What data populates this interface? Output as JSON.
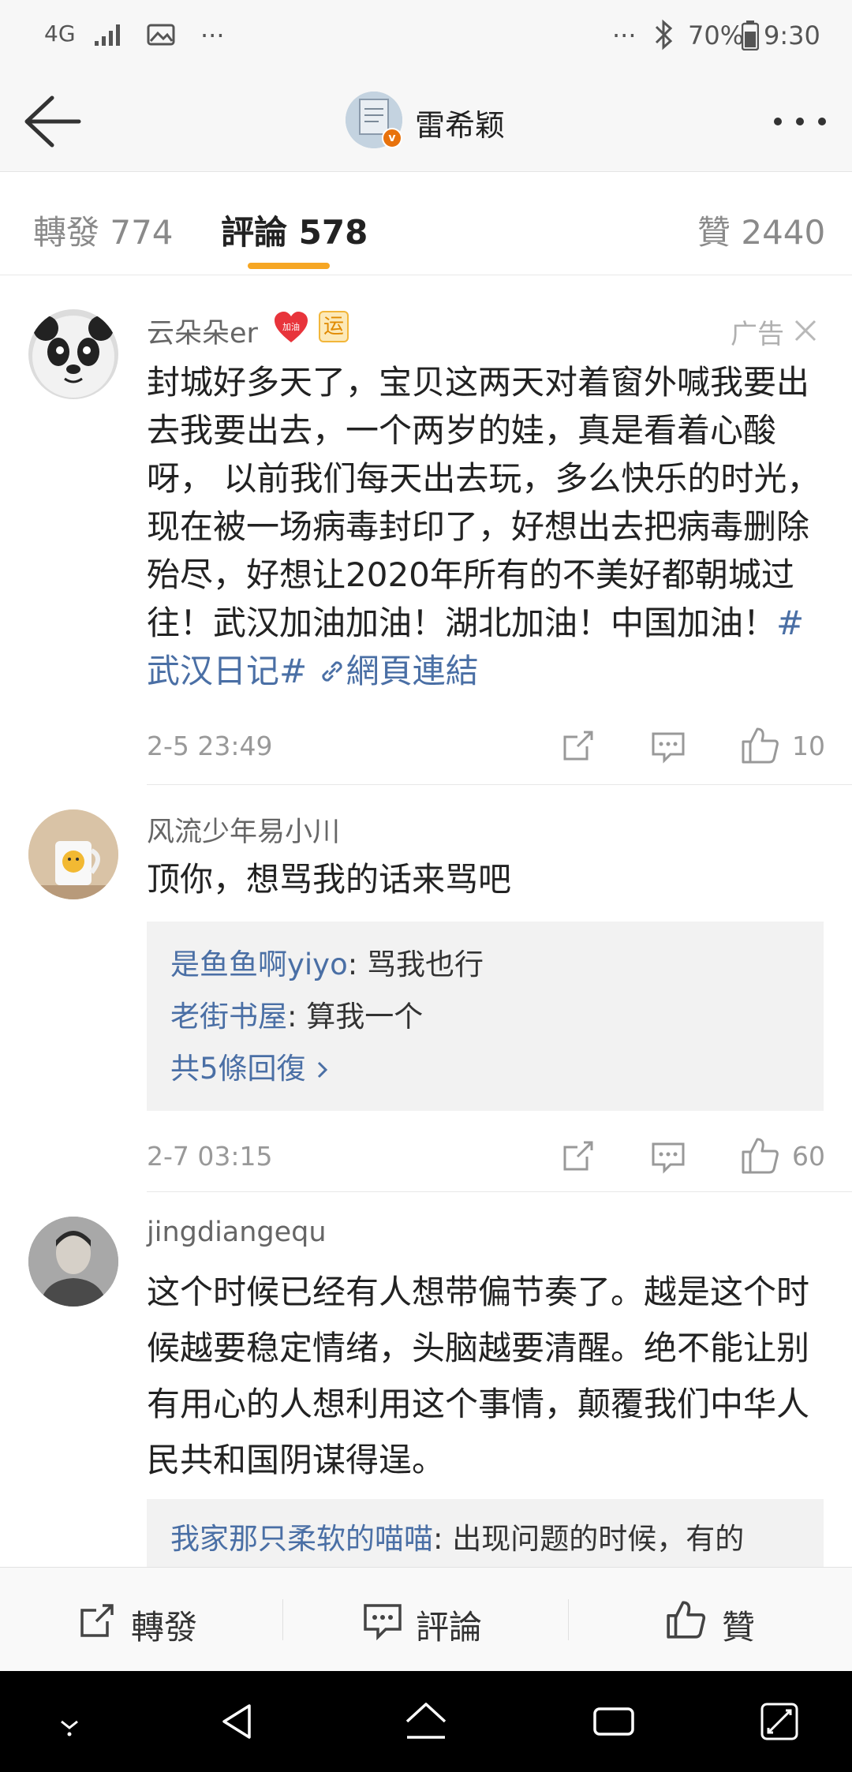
{
  "status_bar": {
    "network": "4G",
    "battery": "70%",
    "time": "9:30",
    "more_left": "···",
    "more_right": "···"
  },
  "header": {
    "title": "雷希颖",
    "verified_badge": "v"
  },
  "tabs": [
    {
      "label": "轉發 774"
    },
    {
      "label": "評論 578"
    },
    {
      "label": "贊 2440"
    }
  ],
  "comments": [
    {
      "username": "云朵朵er",
      "badge_jiayou": "加油",
      "badge_yun": "运",
      "ad_label": "广告",
      "text": "封城好多天了，宝贝这两天对着窗外喊我要出去我要出去，一个两岁的娃，真是看着心酸呀， 以前我们每天出去玩，多么快乐的时光，现在被一场病毒封印了，好想出去把病毒删除殆尽，好想让2020年所有的不美好都朝城过往！武汉加油加油！湖北加油！中国加油！",
      "hashtag": "#武汉日记#",
      "weblink": "網頁連結",
      "time": "2-5 23:49",
      "likes": "10"
    },
    {
      "username": "风流少年易小川",
      "text": "顶你，想骂我的话来骂吧",
      "replies": [
        {
          "user": "是鱼鱼啊yiyo",
          "text": ": 骂我也行"
        },
        {
          "user": "老街书屋",
          "text": ": 算我一个"
        }
      ],
      "reply_more": "共5條回復",
      "time": "2-7 03:15",
      "likes": "60"
    },
    {
      "username": "jingdiangequ",
      "text": "这个时候已经有人想带偏节奏了。越是这个时候越要稳定情绪，头脑越要清醒。绝不能让别有用心的人想利用这个事情，颠覆我们中华人民共和国阴谋得逞。",
      "replies": [
        {
          "user": "我家那只柔软的喵喵",
          "text": ": 出现问题的时候，有的"
        }
      ]
    }
  ],
  "bottom_bar": {
    "repost": "轉發",
    "comment": "評論",
    "like": "贊"
  },
  "colors": {
    "accent": "#f6a623",
    "link": "#4a6fa5",
    "muted": "#999999"
  }
}
